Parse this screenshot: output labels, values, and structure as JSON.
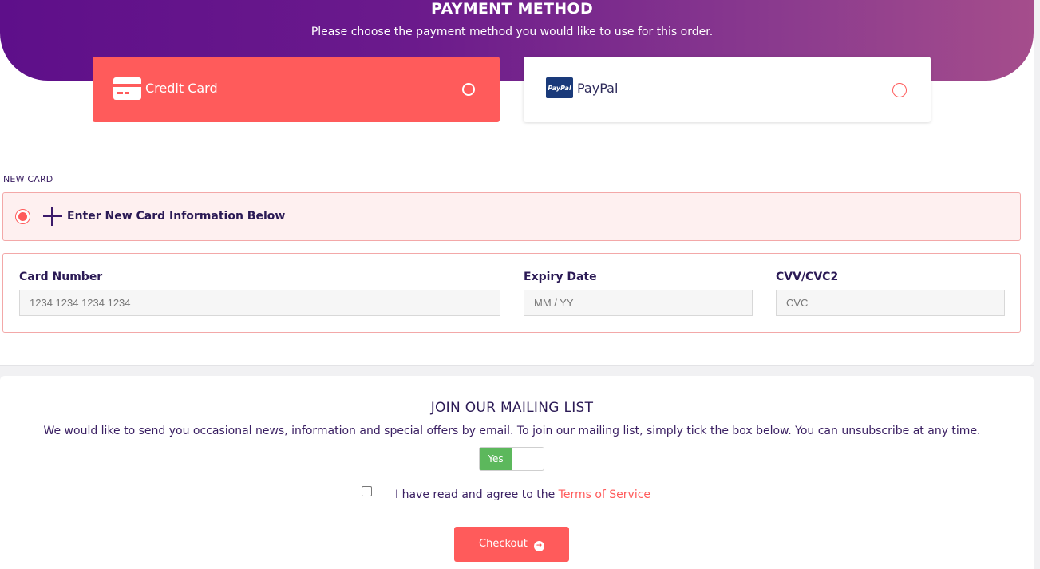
{
  "header": {
    "title": "PAYMENT METHOD",
    "subtitle": "Please choose the payment method you would like to use for this order."
  },
  "payment_methods": [
    {
      "label": "Credit Card",
      "icon": "credit-card-icon",
      "selected": true
    },
    {
      "label": "PayPal",
      "icon": "paypal-logo",
      "logo_text": "PayPal",
      "selected": false
    }
  ],
  "new_card": {
    "section_label": "NEW CARD",
    "option_text": "Enter New Card Information Below"
  },
  "card_form": {
    "card_number_label": "Card Number",
    "card_number_placeholder": "1234 1234 1234 1234",
    "expiry_label": "Expiry Date",
    "expiry_placeholder": "MM / YY",
    "cvv_label": "CVV/CVC2",
    "cvv_placeholder": "CVC"
  },
  "mailing_list": {
    "title": "JOIN OUR MAILING LIST",
    "text": "We would like to send you occasional news, information and special offers by email. To join our mailing list, simply tick the box below. You can unsubscribe at any time.",
    "toggle_label": "Yes"
  },
  "terms": {
    "text": "I have read and agree to the ",
    "link": "Terms of Service"
  },
  "checkout": {
    "label": "Checkout"
  },
  "colors": {
    "accent": "#ff5b5b",
    "brand_purple": "#5e0f8a",
    "toggle_green": "#5cb85c"
  }
}
